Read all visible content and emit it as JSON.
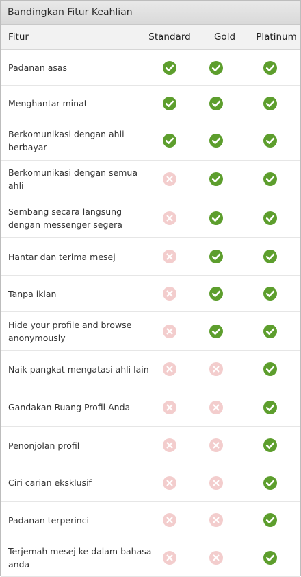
{
  "title": "Bandingkan Fitur Keahlian",
  "columns": [
    "Fitur",
    "Standard",
    "Gold",
    "Platinum"
  ],
  "rows": [
    {
      "label": "Padanan asas",
      "standard": true,
      "gold": true,
      "platinum": true
    },
    {
      "label": "Menghantar minat",
      "standard": true,
      "gold": true,
      "platinum": true
    },
    {
      "label": "Berkomunikasi dengan ahli berbayar",
      "standard": true,
      "gold": true,
      "platinum": true
    },
    {
      "label": "Berkomunikasi dengan semua ahli",
      "standard": false,
      "gold": true,
      "platinum": true
    },
    {
      "label": "Sembang secara langsung dengan messenger segera",
      "standard": false,
      "gold": true,
      "platinum": true
    },
    {
      "label": "Hantar dan terima mesej",
      "standard": false,
      "gold": true,
      "platinum": true
    },
    {
      "label": "Tanpa iklan",
      "standard": false,
      "gold": true,
      "platinum": true
    },
    {
      "label": "Hide your profile and browse anonymously",
      "standard": false,
      "gold": true,
      "platinum": true
    },
    {
      "label": "Naik pangkat mengatasi ahli lain",
      "standard": false,
      "gold": false,
      "platinum": true
    },
    {
      "label": "Gandakan Ruang Profil Anda",
      "standard": false,
      "gold": false,
      "platinum": true
    },
    {
      "label": "Penonjolan profil",
      "standard": false,
      "gold": false,
      "platinum": true
    },
    {
      "label": "Ciri carian eksklusif",
      "standard": false,
      "gold": false,
      "platinum": true
    },
    {
      "label": "Padanan terperinci",
      "standard": false,
      "gold": false,
      "platinum": true
    },
    {
      "label": "Terjemah mesej ke dalam bahasa anda",
      "standard": false,
      "gold": false,
      "platinum": true
    }
  ],
  "colors": {
    "check": "#5d9e2d",
    "cross": "#f3cdcd"
  },
  "icons": {
    "included": "check-circle-icon",
    "excluded": "x-circle-icon"
  }
}
